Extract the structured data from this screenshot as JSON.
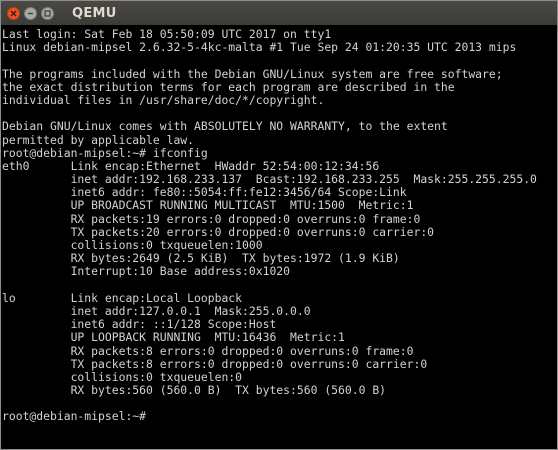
{
  "window": {
    "title": "QEMU"
  },
  "terminal": {
    "lines": [
      "Last login: Sat Feb 18 05:50:09 UTC 2017 on tty1",
      "Linux debian-mipsel 2.6.32-5-4kc-malta #1 Tue Sep 24 01:20:35 UTC 2013 mips",
      "",
      "The programs included with the Debian GNU/Linux system are free software;",
      "the exact distribution terms for each program are described in the",
      "individual files in /usr/share/doc/*/copyright.",
      "",
      "Debian GNU/Linux comes with ABSOLUTELY NO WARRANTY, to the extent",
      "permitted by applicable law.",
      "root@debian-mipsel:~# ifconfig",
      "eth0      Link encap:Ethernet  HWaddr 52:54:00:12:34:56",
      "          inet addr:192.168.233.137  Bcast:192.168.233.255  Mask:255.255.255.0",
      "          inet6 addr: fe80::5054:ff:fe12:3456/64 Scope:Link",
      "          UP BROADCAST RUNNING MULTICAST  MTU:1500  Metric:1",
      "          RX packets:19 errors:0 dropped:0 overruns:0 frame:0",
      "          TX packets:20 errors:0 dropped:0 overruns:0 carrier:0",
      "          collisions:0 txqueuelen:1000",
      "          RX bytes:2649 (2.5 KiB)  TX bytes:1972 (1.9 KiB)",
      "          Interrupt:10 Base address:0x1020",
      "",
      "lo        Link encap:Local Loopback",
      "          inet addr:127.0.0.1  Mask:255.0.0.0",
      "          inet6 addr: ::1/128 Scope:Host",
      "          UP LOOPBACK RUNNING  MTU:16436  Metric:1",
      "          RX packets:8 errors:0 dropped:0 overruns:0 frame:0",
      "          TX packets:8 errors:0 dropped:0 overruns:0 carrier:0",
      "          collisions:0 txqueuelen:0",
      "          RX bytes:560 (560.0 B)  TX bytes:560 (560.0 B)",
      "",
      "root@debian-mipsel:~#"
    ]
  },
  "colors": {
    "background": "#000000",
    "foreground": "#d3d3d3",
    "titlebar": "#3c3b37",
    "close_button": "#e95420"
  }
}
